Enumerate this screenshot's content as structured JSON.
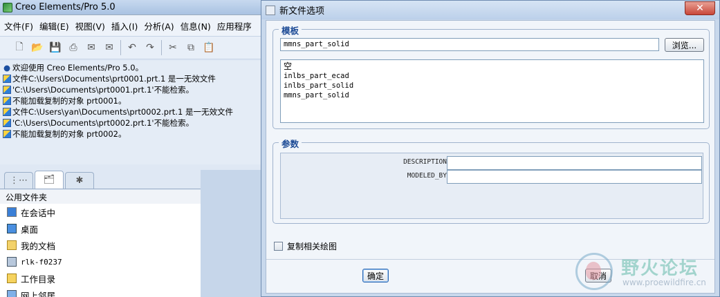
{
  "main_window": {
    "title": "Creo Elements/Pro 5.0",
    "menu": [
      "文件(F)",
      "编辑(E)",
      "视图(V)",
      "插入(I)",
      "分析(A)",
      "信息(N)",
      "应用程序"
    ],
    "messages": [
      {
        "icon": "bullet",
        "text": "欢迎使用 Creo Elements/Pro 5.0。"
      },
      {
        "icon": "warning",
        "text": "文件C:\\Users\\Documents\\prt0001.prt.1 是一无效文件"
      },
      {
        "icon": "warning",
        "text": "'C:\\Users\\Documents\\prt0001.prt.1'不能检索。"
      },
      {
        "icon": "warning",
        "text": "不能加载复制的对象 prt0001。"
      },
      {
        "icon": "warning",
        "text": "文件C:\\Users\\yan\\Documents\\prt0002.prt.1 是一无效文件"
      },
      {
        "icon": "warning",
        "text": "'C:\\Users\\Documents\\prt0002.prt.1'不能检索。"
      },
      {
        "icon": "warning",
        "text": "不能加载复制的对象 prt0002。"
      }
    ],
    "folder_browser": {
      "header": "公用文件夹",
      "items": [
        {
          "label": "在会话中",
          "icon": "session-icon"
        },
        {
          "label": "桌面",
          "icon": "desktop-icon"
        },
        {
          "label": "我的文档",
          "icon": "documents-icon"
        },
        {
          "label": "rlk-f0237",
          "icon": "computer-icon"
        },
        {
          "label": "工作目录",
          "icon": "working-dir-icon"
        },
        {
          "label": "网上邻居",
          "icon": "network-icon"
        }
      ]
    }
  },
  "dialog": {
    "title": "新文件选项",
    "template_group": {
      "label": "模板",
      "selected_template": "mmns_part_solid",
      "browse_label": "浏览...",
      "options": [
        "空",
        "inlbs_part_ecad",
        "inlbs_part_solid",
        "mmns_part_solid"
      ]
    },
    "params_group": {
      "label": "参数",
      "params": [
        {
          "name": "DESCRIPTION",
          "value": ""
        },
        {
          "name": "MODELED_BY",
          "value": ""
        }
      ]
    },
    "copy_drawing_label": "复制相关绘图",
    "copy_drawing_checked": false,
    "ok_label": "确定",
    "cancel_label": "取消"
  },
  "watermark": {
    "text": "野火论坛",
    "url": "www.proewildfire.cn"
  }
}
